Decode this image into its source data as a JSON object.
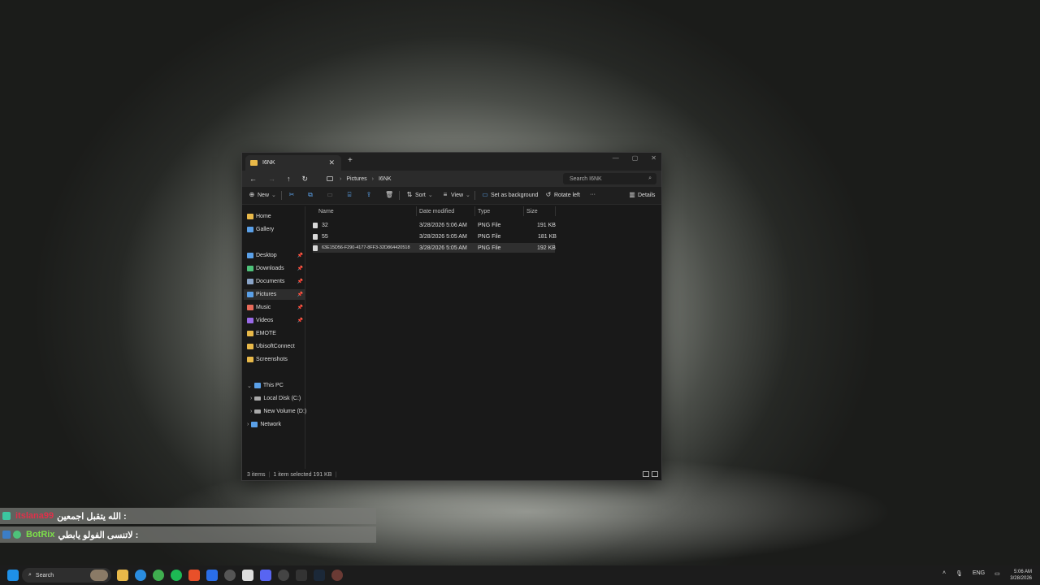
{
  "window": {
    "tab_title": "I6NK",
    "close_tab": "✕",
    "new_tab": "+",
    "controls": [
      "—",
      "▢",
      "✕"
    ]
  },
  "address": {
    "crumbs": [
      "Pictures",
      "I6NK"
    ],
    "search_placeholder": "Search I6NK"
  },
  "toolbar": {
    "new_label": "New",
    "sort_label": "Sort",
    "view_label": "View",
    "set_background_label": "Set as background",
    "rotate_left_label": "Rotate left",
    "more_label": "···",
    "details_label": "Details"
  },
  "sidebar": {
    "items": [
      {
        "label": "Home",
        "color": "#e9b949"
      },
      {
        "label": "Gallery",
        "color": "#5aa0e8"
      },
      {
        "label": "Desktop",
        "color": "#5aa0e8",
        "pinned": true
      },
      {
        "label": "Downloads",
        "color": "#4ec27a",
        "pinned": true
      },
      {
        "label": "Documents",
        "color": "#8aa4c8",
        "pinned": true
      },
      {
        "label": "Pictures",
        "color": "#5aa0e8",
        "pinned": true,
        "selected": true
      },
      {
        "label": "Music",
        "color": "#e86a5a",
        "pinned": true
      },
      {
        "label": "Videos",
        "color": "#9a6ae8",
        "pinned": true
      },
      {
        "label": "EMOTE",
        "color": "#e9b949"
      },
      {
        "label": "UbisoftConnect",
        "color": "#e9b949"
      },
      {
        "label": "Screenshots",
        "color": "#e9b949"
      },
      {
        "label": "This PC",
        "color": "#5aa0e8"
      },
      {
        "label": "Local Disk (C:)",
        "color": "#aaaaaa"
      },
      {
        "label": "New Volume (D:)",
        "color": "#aaaaaa"
      },
      {
        "label": "Network",
        "color": "#5aa0e8"
      }
    ]
  },
  "columns": [
    "Name",
    "Date modified",
    "Type",
    "Size"
  ],
  "files": [
    {
      "name": "32",
      "date": "3/28/2026 5:06 AM",
      "type": "PNG File",
      "size": "191 KB"
    },
    {
      "name": "55",
      "date": "3/28/2026 5:05 AM",
      "type": "PNG File",
      "size": "181 KB"
    },
    {
      "name": "63E15D56-F290-4177-8FF3-32D864420518",
      "date": "3/28/2026 5:05 AM",
      "type": "PNG File",
      "size": "192 KB"
    }
  ],
  "status": {
    "count": "3 items",
    "selected": "1 item selected  191 KB"
  },
  "chat": [
    {
      "user": "itslana99",
      "user_color": "#e0304a",
      "message": "الله يتقبل اجمعين :"
    },
    {
      "user": "BotRix",
      "user_color": "#7de04a",
      "message": "لاتنسى الفولو يابطي :"
    }
  ],
  "taskbar": {
    "search_label": "Search",
    "language": "ENG",
    "time": "5:06 AM",
    "date": "3/28/2026"
  }
}
